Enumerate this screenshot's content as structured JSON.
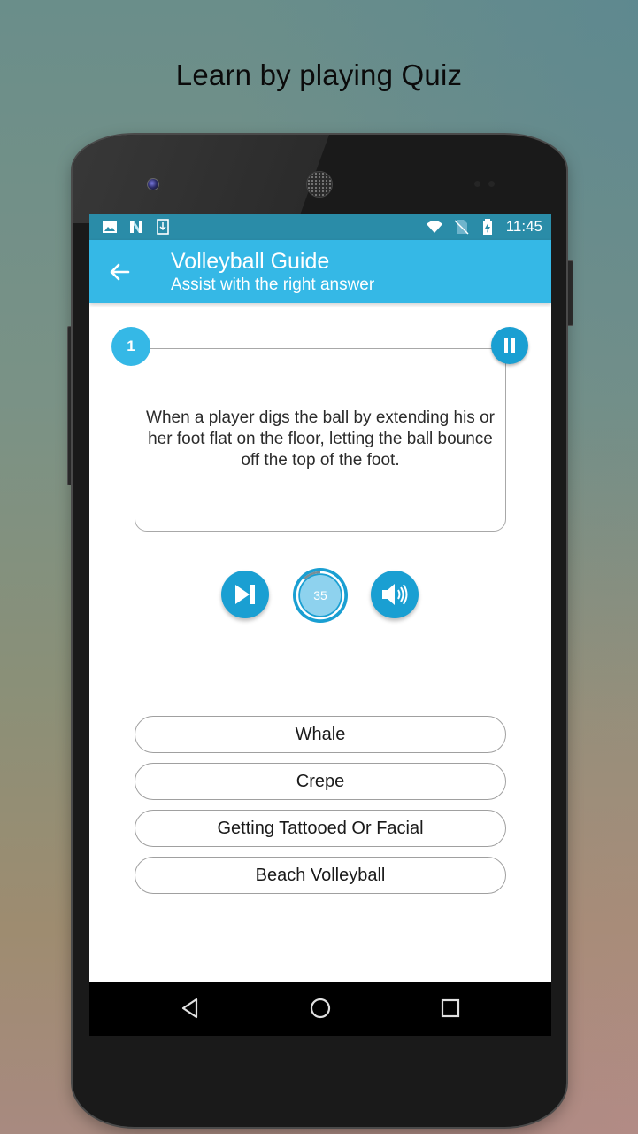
{
  "promo": {
    "headline": "Learn by playing Quiz"
  },
  "status_bar": {
    "left_icons": [
      "image-icon",
      "n-logo-icon",
      "download-icon"
    ],
    "right_icons": [
      "wifi-icon",
      "no-sim-icon",
      "battery-charging-icon"
    ],
    "time": "11:45"
  },
  "app_bar": {
    "back_icon": "arrow-left-icon",
    "title": "Volleyball Guide",
    "subtitle": "Assist with the right answer"
  },
  "question": {
    "number": "1",
    "text": "When a player digs the ball by extending his or her foot flat on the floor, letting the ball bounce off the top of the foot.",
    "pause_icon": "pause-icon"
  },
  "controls": {
    "skip_icon": "skip-next-icon",
    "timer_value": "35",
    "timer_elapsed_fraction": 0.12,
    "sound_icon": "volume-icon"
  },
  "answers": [
    {
      "label": "Whale"
    },
    {
      "label": "Crepe"
    },
    {
      "label": "Getting Tattooed Or Facial"
    },
    {
      "label": "Beach Volleyball"
    }
  ],
  "nav_bar": {
    "back": "nav-back-icon",
    "home": "nav-home-icon",
    "recents": "nav-recents-icon"
  },
  "colors": {
    "primary": "#35b8e6",
    "primary_dark": "#1a9fd2",
    "status_bar": "#2a8ca8",
    "timer_fill": "#8ed2ee"
  }
}
